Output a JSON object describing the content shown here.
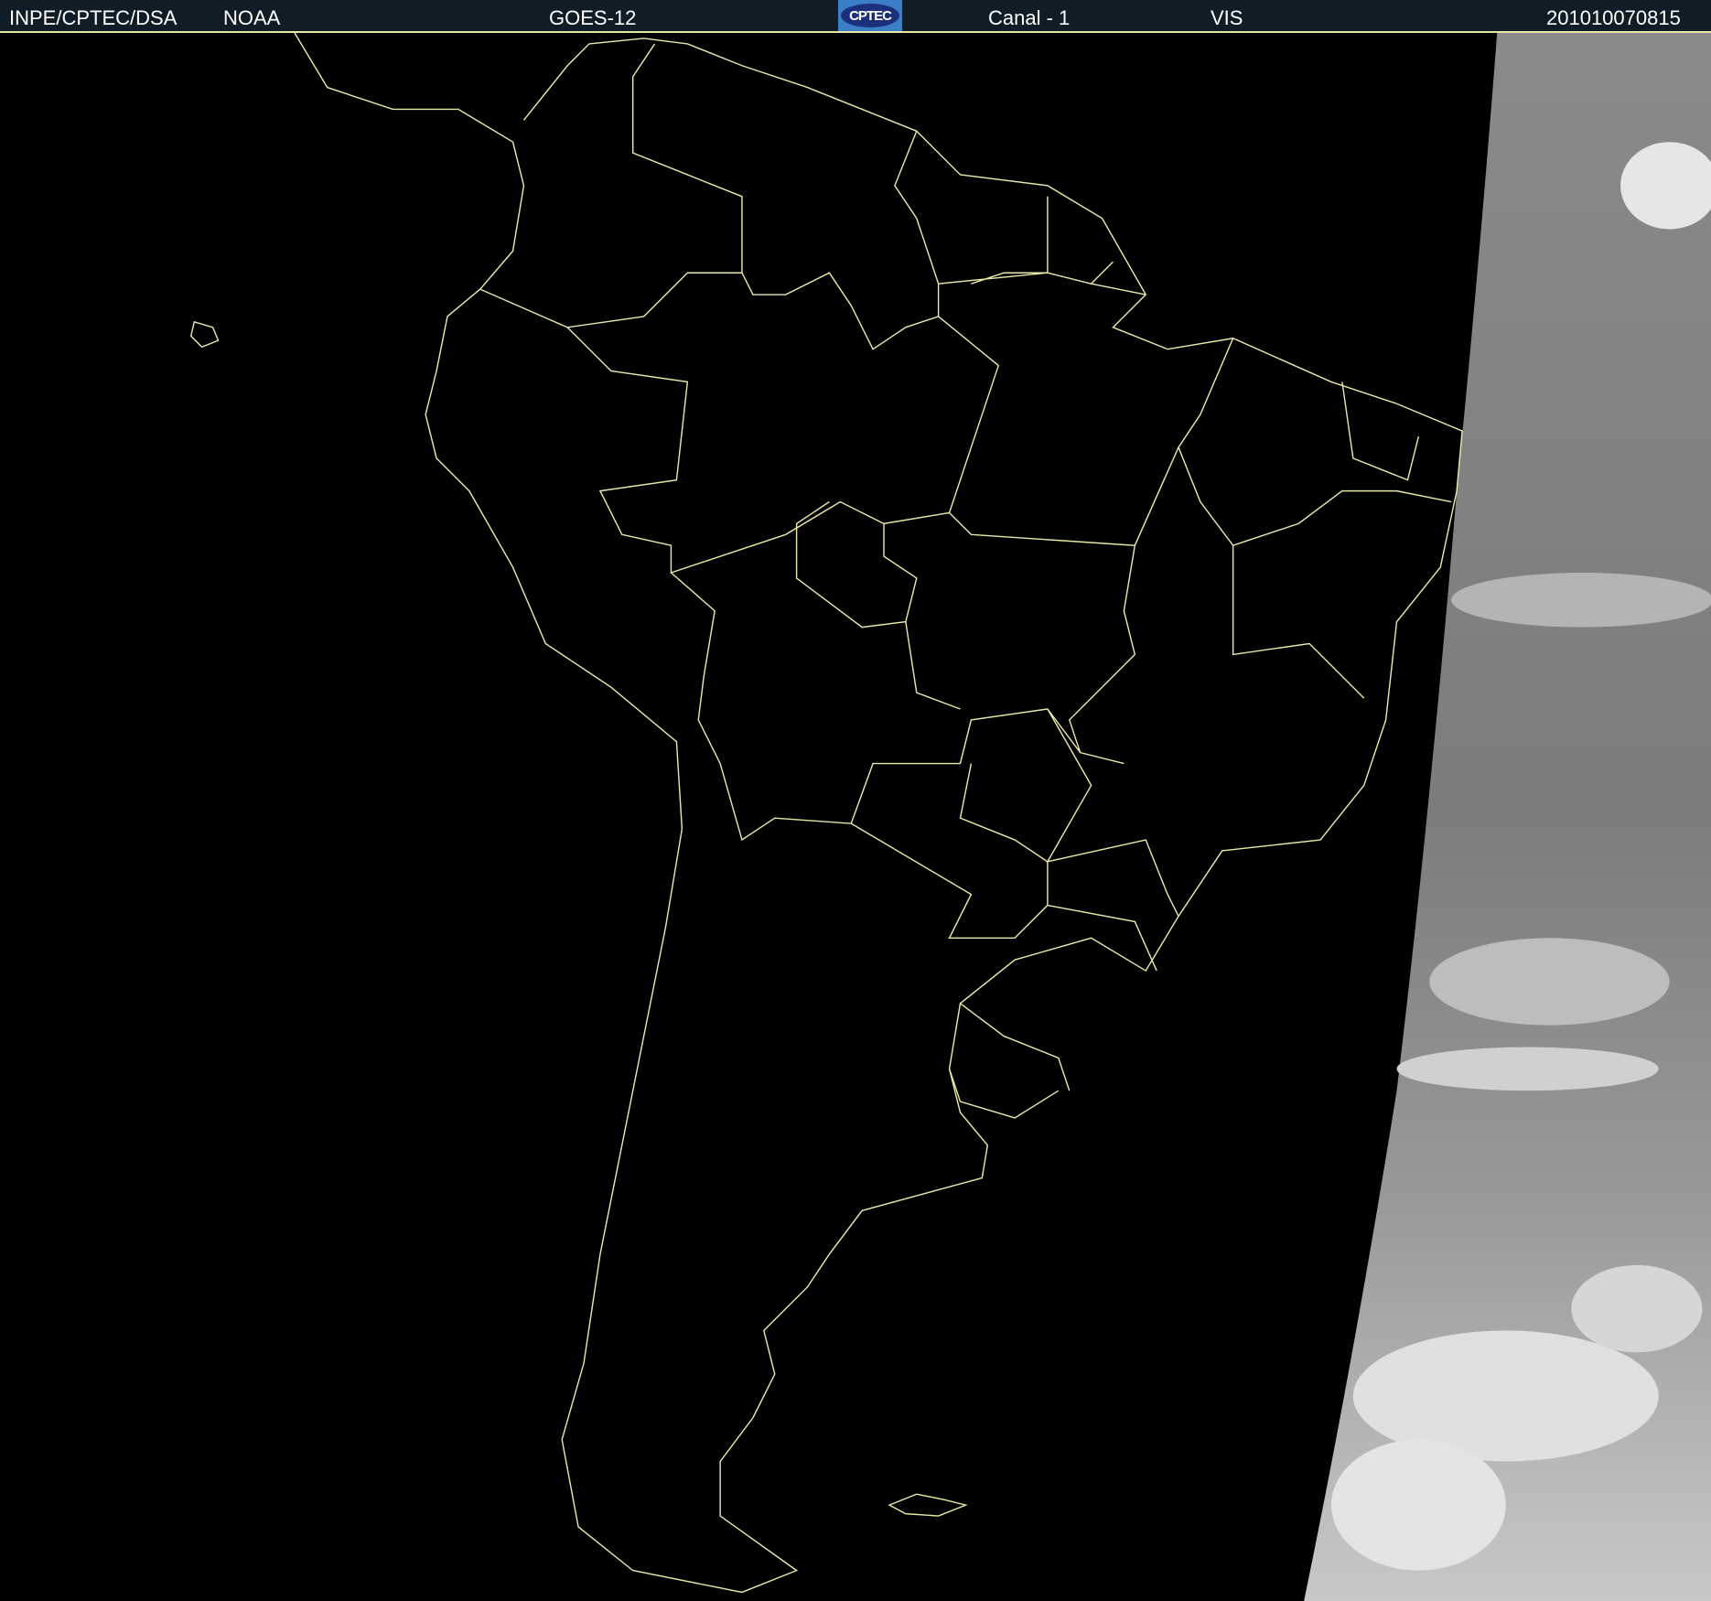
{
  "header": {
    "institution": "INPE/CPTEC/DSA",
    "agency": "NOAA",
    "satellite": "GOES-12",
    "logo_text": "CPTEC",
    "channel": "Canal - 1",
    "band": "VIS",
    "timestamp": "201010070815"
  },
  "colors": {
    "header_bg": "#111d26",
    "outline": "#e8e8a8",
    "background": "#000000"
  }
}
